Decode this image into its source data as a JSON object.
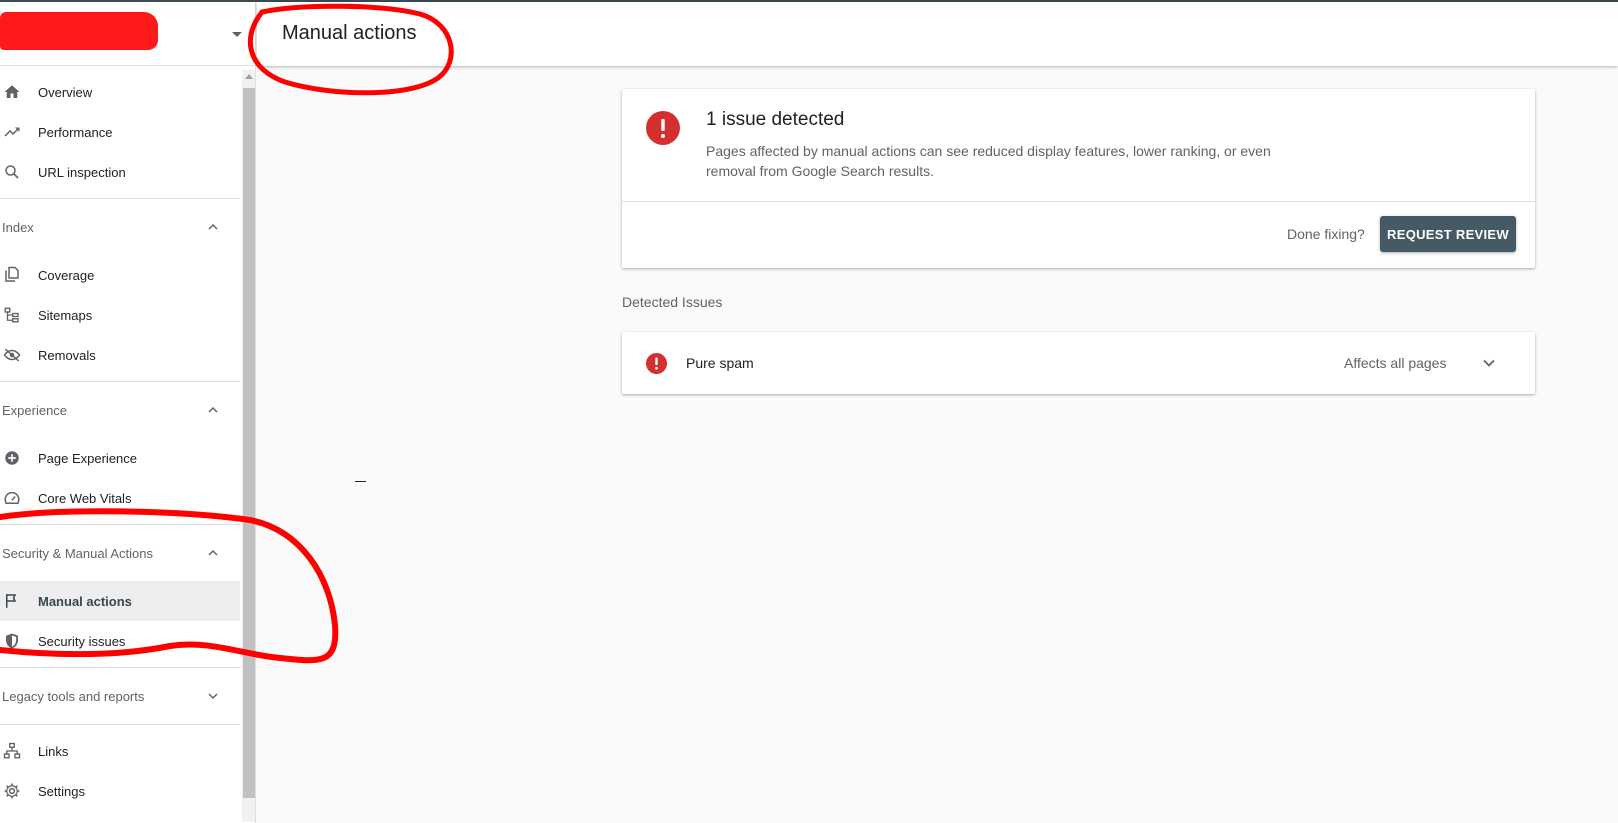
{
  "header": {
    "page_title": "Manual actions"
  },
  "sidebar": {
    "top_items": [
      {
        "label": "Overview",
        "icon": "home-icon"
      },
      {
        "label": "Performance",
        "icon": "trending-up-icon"
      },
      {
        "label": "URL inspection",
        "icon": "search-icon"
      }
    ],
    "sections": [
      {
        "title": "Index",
        "expanded": true,
        "items": [
          {
            "label": "Coverage",
            "icon": "copy-icon"
          },
          {
            "label": "Sitemaps",
            "icon": "sitemap-icon"
          },
          {
            "label": "Removals",
            "icon": "eye-off-icon"
          }
        ]
      },
      {
        "title": "Experience",
        "expanded": true,
        "items": [
          {
            "label": "Page Experience",
            "icon": "plus-circle-icon"
          },
          {
            "label": "Core Web Vitals",
            "icon": "speedometer-icon"
          }
        ]
      },
      {
        "title": "Security & Manual Actions",
        "expanded": true,
        "items": [
          {
            "label": "Manual actions",
            "icon": "flag-icon",
            "active": true
          },
          {
            "label": "Security issues",
            "icon": "shield-icon"
          }
        ]
      },
      {
        "title": "Legacy tools and reports",
        "expanded": false,
        "items": []
      }
    ],
    "bottom_items": [
      {
        "label": "Links",
        "icon": "links-icon"
      },
      {
        "label": "Settings",
        "icon": "gear-icon"
      }
    ]
  },
  "summary": {
    "title": "1 issue detected",
    "description": "Pages affected by manual actions can see reduced display features, lower ranking, or even removal from Google Search results.",
    "done_fixing": "Done fixing?",
    "review_button": "REQUEST REVIEW"
  },
  "detected": {
    "heading": "Detected Issues",
    "issues": [
      {
        "name": "Pure spam",
        "scope": "Affects all pages"
      }
    ]
  },
  "colors": {
    "accent": "#455a64",
    "error": "#d32f2f",
    "annotation": "#ff0000"
  }
}
